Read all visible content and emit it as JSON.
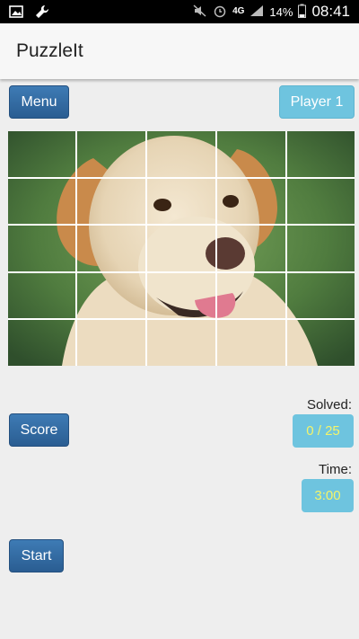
{
  "status_bar": {
    "network": "4G",
    "battery": "14%",
    "time": "08:41",
    "icons": [
      "image-icon",
      "wrench-icon",
      "mute-icon",
      "alarm-icon",
      "signal-icon",
      "battery-icon"
    ]
  },
  "app": {
    "title": "PuzzleIt"
  },
  "toolbar": {
    "menu_label": "Menu",
    "player_label": "Player 1"
  },
  "puzzle": {
    "rows": 5,
    "cols": 5,
    "image_subject": "dog-photo"
  },
  "stats": {
    "solved_label": "Solved:",
    "solved_value": "0 / 25",
    "time_label": "Time:",
    "time_value": "3:00"
  },
  "actions": {
    "score_label": "Score",
    "start_label": "Start"
  },
  "colors": {
    "primary_button": "#2e6599",
    "secondary_button": "#6ec4df",
    "value_text": "#f4f46a"
  }
}
